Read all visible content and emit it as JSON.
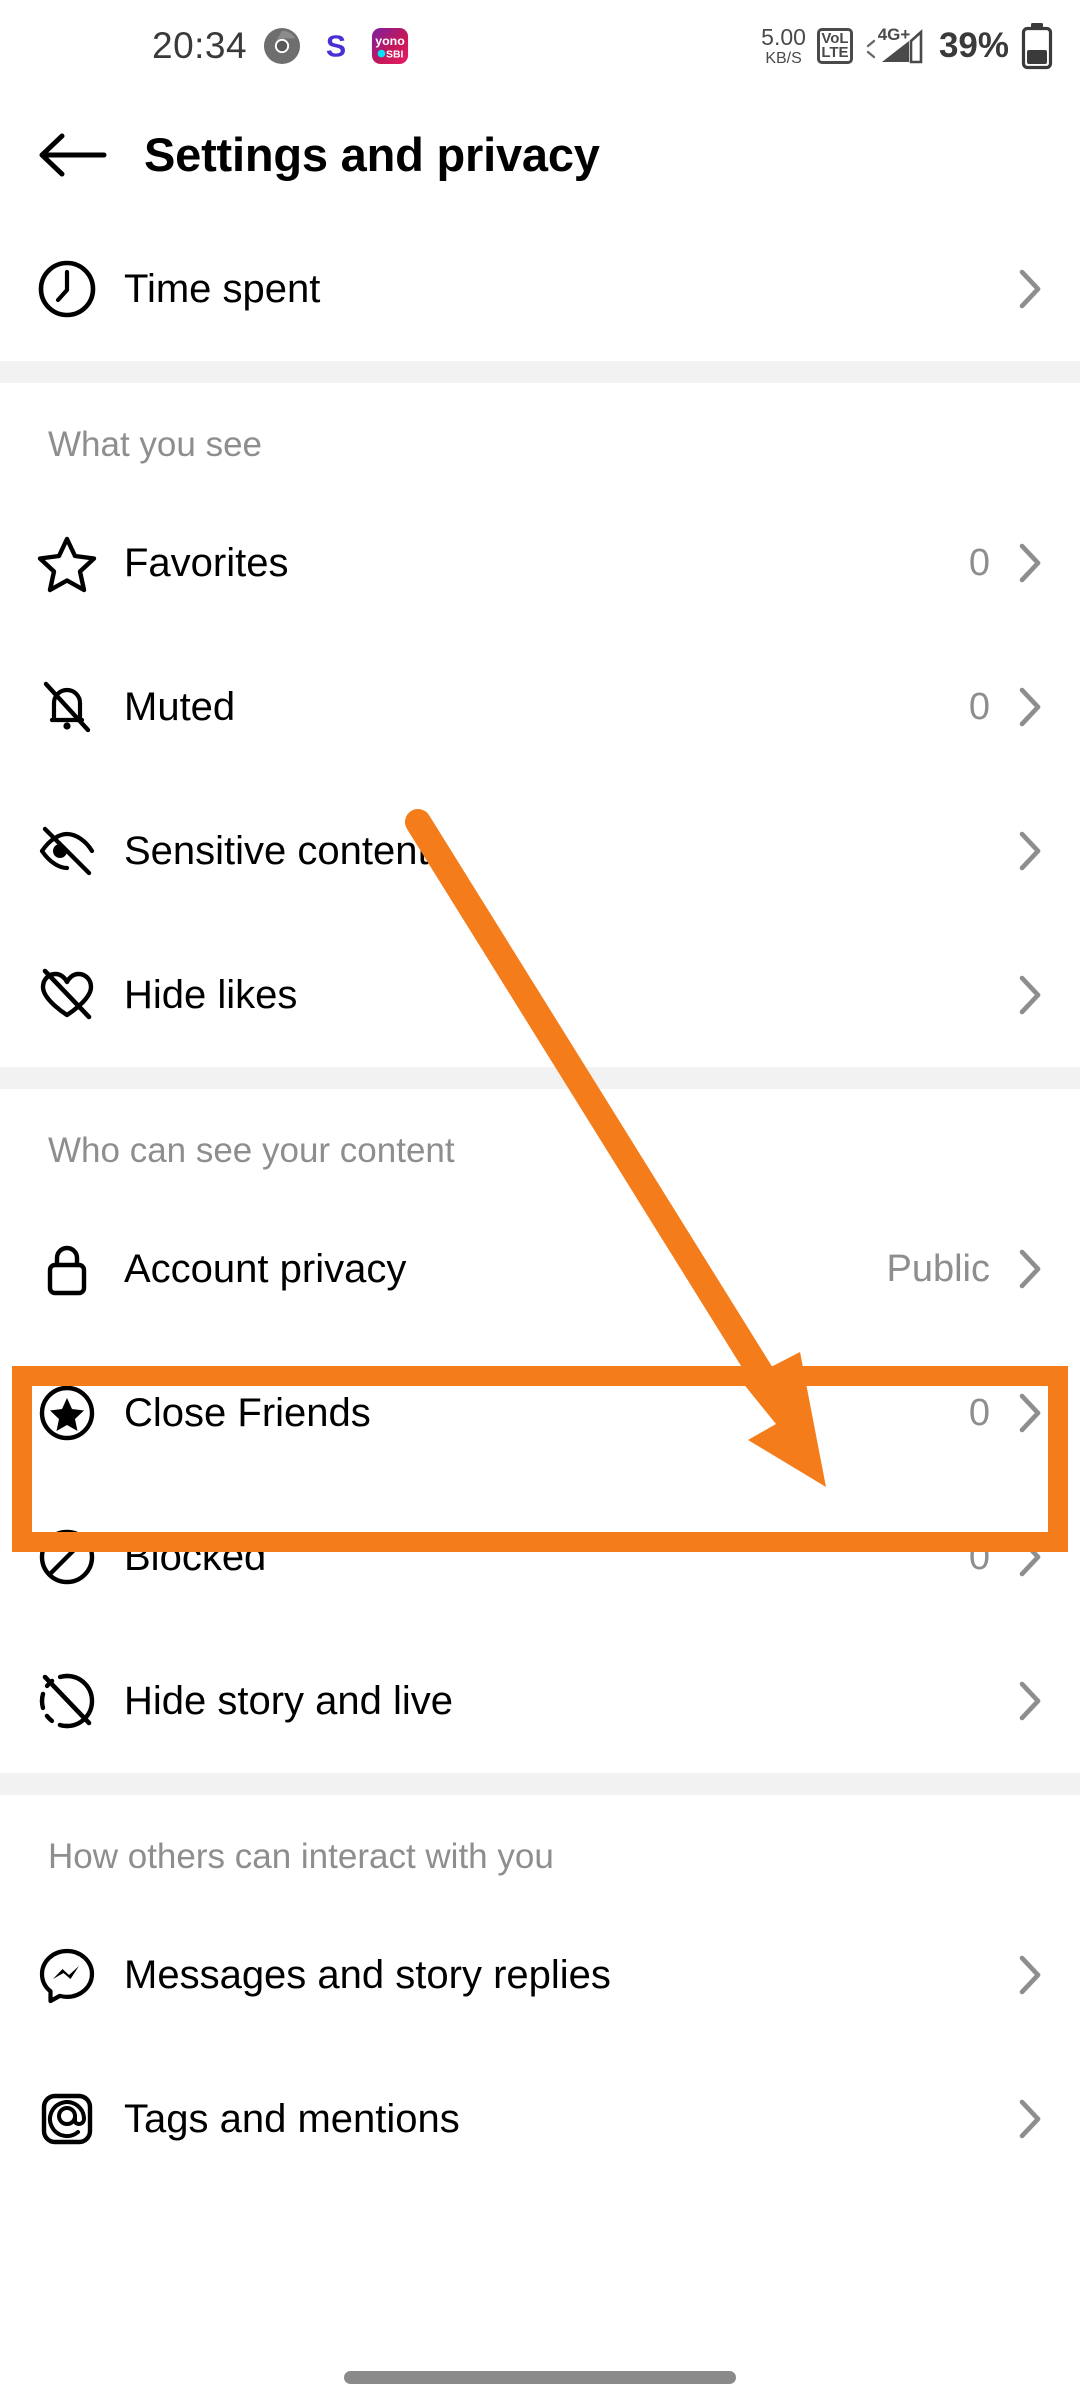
{
  "statusbar": {
    "time": "20:34",
    "app_icons": [
      "chrome-icon",
      "s-app-icon",
      "yono-sbi-icon"
    ],
    "yono_line1": "yono",
    "yono_line2": "SBI",
    "s_letter": "S",
    "net_speed_value": "5.00",
    "net_speed_unit": "KB/S",
    "volte_line1": "VoL",
    "volte_line2": "LTE",
    "network_type": "4G+",
    "battery": "39%"
  },
  "header": {
    "back_icon": "back-arrow-icon",
    "title": "Settings and privacy"
  },
  "sections": [
    {
      "title": null,
      "items": [
        {
          "icon": "clock-icon",
          "label": "Time spent",
          "value": ""
        }
      ]
    },
    {
      "title": "What you see",
      "items": [
        {
          "icon": "star-icon",
          "label": "Favorites",
          "value": "0"
        },
        {
          "icon": "bell-slash-icon",
          "label": "Muted",
          "value": "0"
        },
        {
          "icon": "eye-slash-icon",
          "label": "Sensitive content",
          "value": ""
        },
        {
          "icon": "heart-slash-icon",
          "label": "Hide likes",
          "value": ""
        }
      ]
    },
    {
      "title": "Who can see your content",
      "items": [
        {
          "icon": "lock-icon",
          "label": "Account privacy",
          "value": "Public",
          "highlighted": true
        },
        {
          "icon": "star-circle-icon",
          "label": "Close Friends",
          "value": "0"
        },
        {
          "icon": "block-icon",
          "label": "Blocked",
          "value": "0"
        },
        {
          "icon": "story-slash-icon",
          "label": "Hide story and live",
          "value": ""
        }
      ]
    },
    {
      "title": "How others can interact with you",
      "items": [
        {
          "icon": "messenger-icon",
          "label": "Messages and story replies",
          "value": ""
        },
        {
          "icon": "tag-icon",
          "label": "Tags and mentions",
          "value": ""
        }
      ]
    }
  ],
  "annotation": {
    "highlight_color": "#F57C1A",
    "arrow_color": "#F57C1A",
    "highlight_target": "Account privacy",
    "arrow_name": "orange-pointer-arrow",
    "box_name": "orange-highlight-box"
  },
  "colors": {
    "orange": "#F57C1A",
    "value_gray": "#8e8e8e",
    "band_gray": "#f2f2f2",
    "text_black": "#000000"
  }
}
